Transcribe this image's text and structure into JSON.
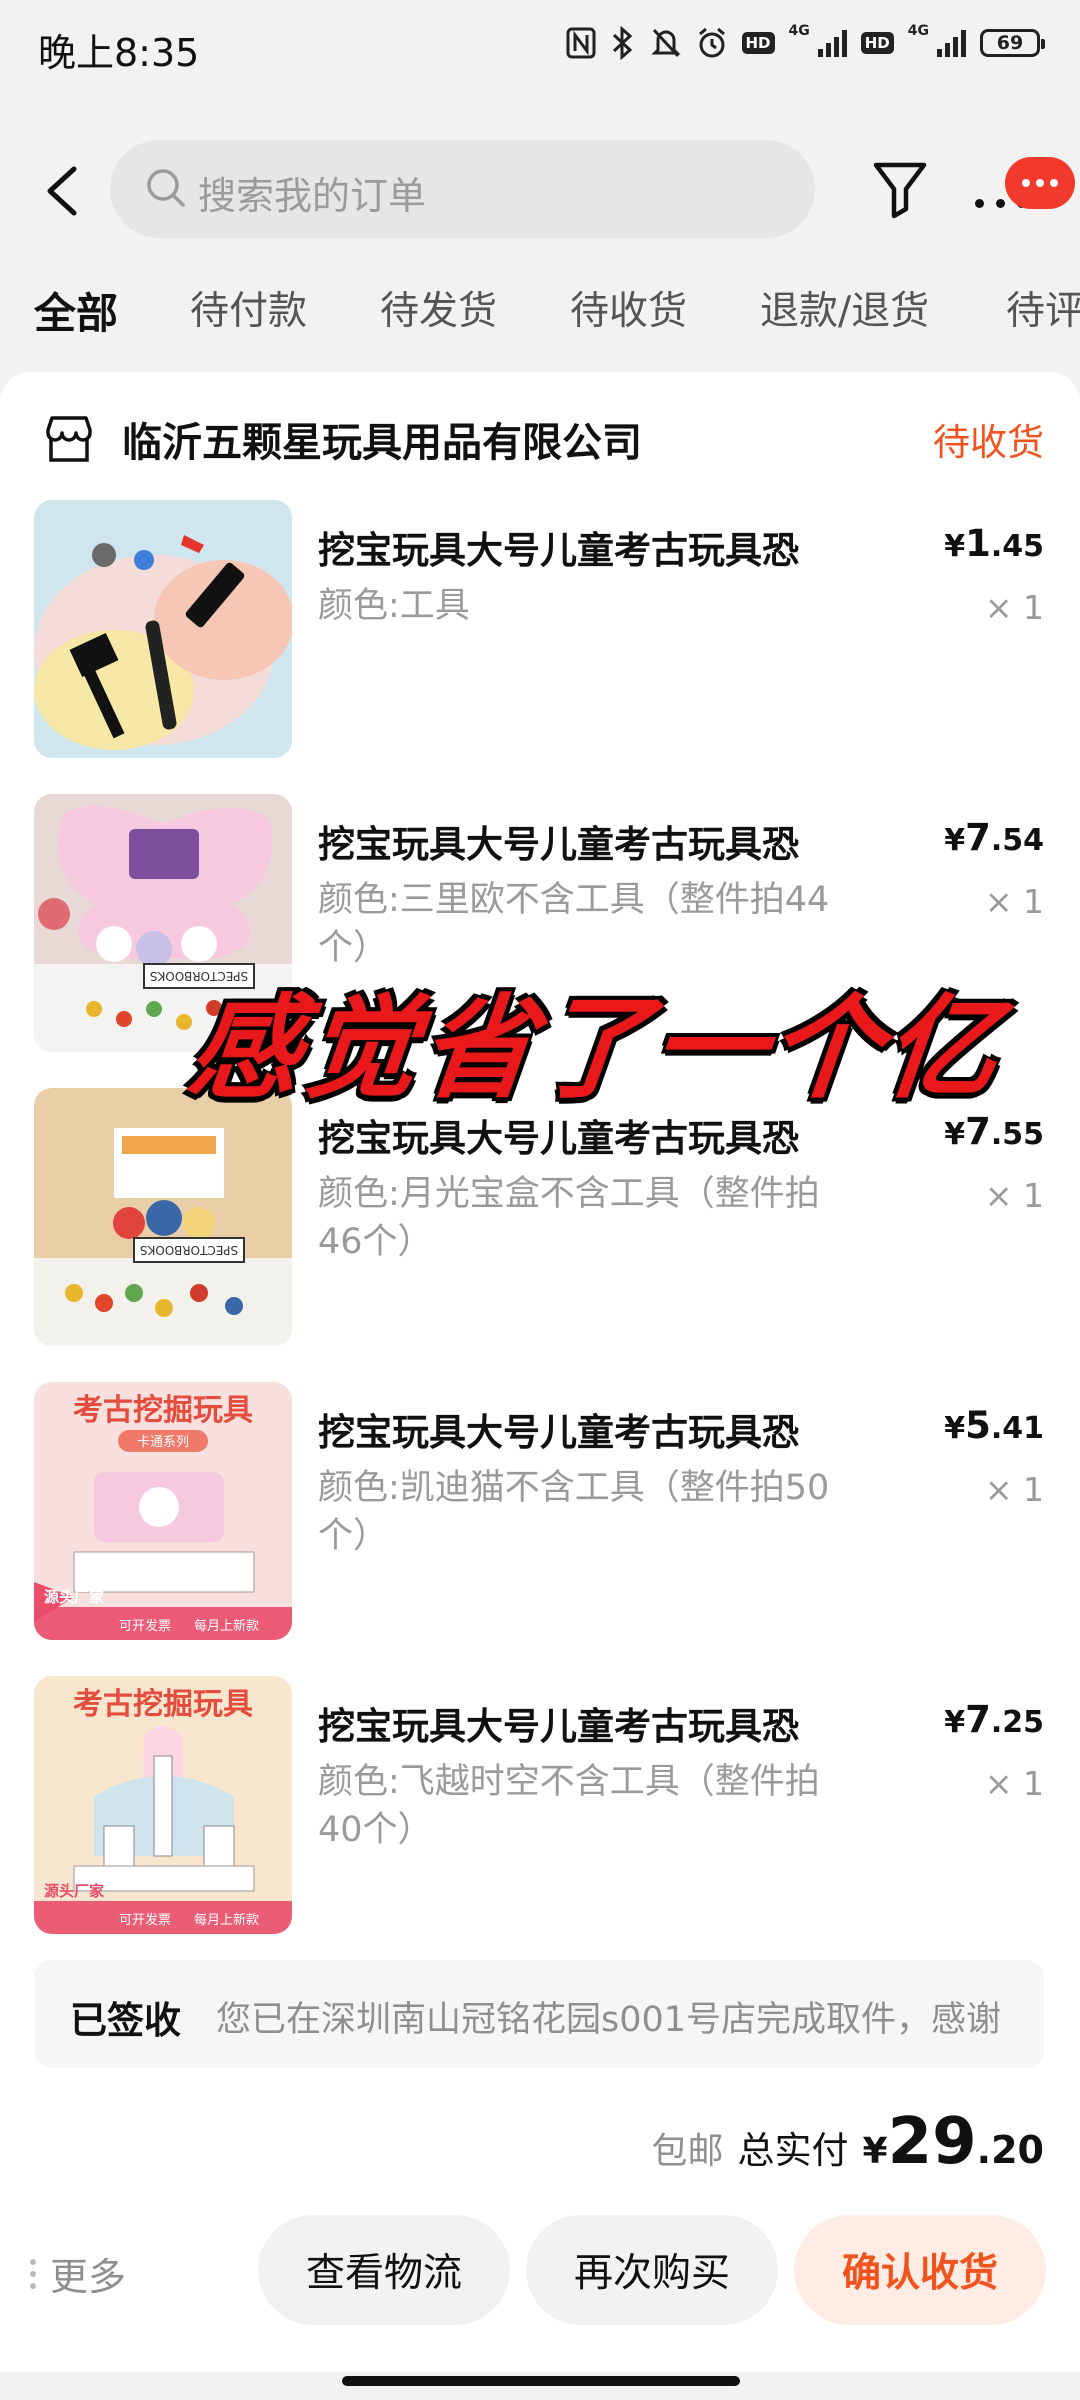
{
  "status_bar": {
    "time": "晚上8:35",
    "battery": "69",
    "network_1": "4G",
    "network_2": "4G",
    "hd_1": "HD",
    "hd_2": "HD"
  },
  "search": {
    "placeholder": "搜索我的订单"
  },
  "tabs": [
    "全部",
    "待付款",
    "待发货",
    "待收货",
    "退款/退货",
    "待评"
  ],
  "shop": {
    "name": "临沂五颗星玩具用品有限公司",
    "status": "待收货"
  },
  "items": [
    {
      "title": "挖宝玩具大号儿童考古玩具恐",
      "spec": "颜色:工具",
      "price_cur": "¥",
      "price_int": "1",
      "price_dec": ".45",
      "qty": "× 1"
    },
    {
      "title": "挖宝玩具大号儿童考古玩具恐",
      "spec": "颜色:三里欧不含工具（整件拍44个）",
      "price_cur": "¥",
      "price_int": "7",
      "price_dec": ".54",
      "qty": "× 1"
    },
    {
      "title": "挖宝玩具大号儿童考古玩具恐",
      "spec": "颜色:月光宝盒不含工具（整件拍46个）",
      "price_cur": "¥",
      "price_int": "7",
      "price_dec": ".55",
      "qty": "× 1"
    },
    {
      "title": "挖宝玩具大号儿童考古玩具恐",
      "spec": "颜色:凯迪猫不含工具（整件拍50个）",
      "price_cur": "¥",
      "price_int": "5",
      "price_dec": ".41",
      "qty": "× 1"
    },
    {
      "title": "挖宝玩具大号儿童考古玩具恐",
      "spec": "颜色:飞越时空不含工具（整件拍40个）",
      "price_cur": "¥",
      "price_int": "7",
      "price_dec": ".25",
      "qty": "× 1"
    }
  ],
  "thumb_texts": {
    "book": "SPECTORBOOKS",
    "banner": "考古挖掘玩具",
    "series": "卡通系列",
    "source": "源头厂家",
    "invoice": "可开发票",
    "monthly": "每月上新款"
  },
  "overlay": "感觉省了一个亿",
  "delivery": {
    "status": "已签收",
    "text": "您已在深圳南山冠铭花园s001号店完成取件，感谢"
  },
  "total": {
    "shipping": "包邮",
    "label": "总实付",
    "cur": "¥",
    "int": "29",
    "dec": ".20"
  },
  "actions": {
    "more": "更多",
    "logistics": "查看物流",
    "rebuy": "再次购买",
    "confirm": "确认收货"
  },
  "colors": {
    "accent": "#f0531e",
    "overlay": "#e8181b",
    "bubble": "#f23a2c"
  }
}
